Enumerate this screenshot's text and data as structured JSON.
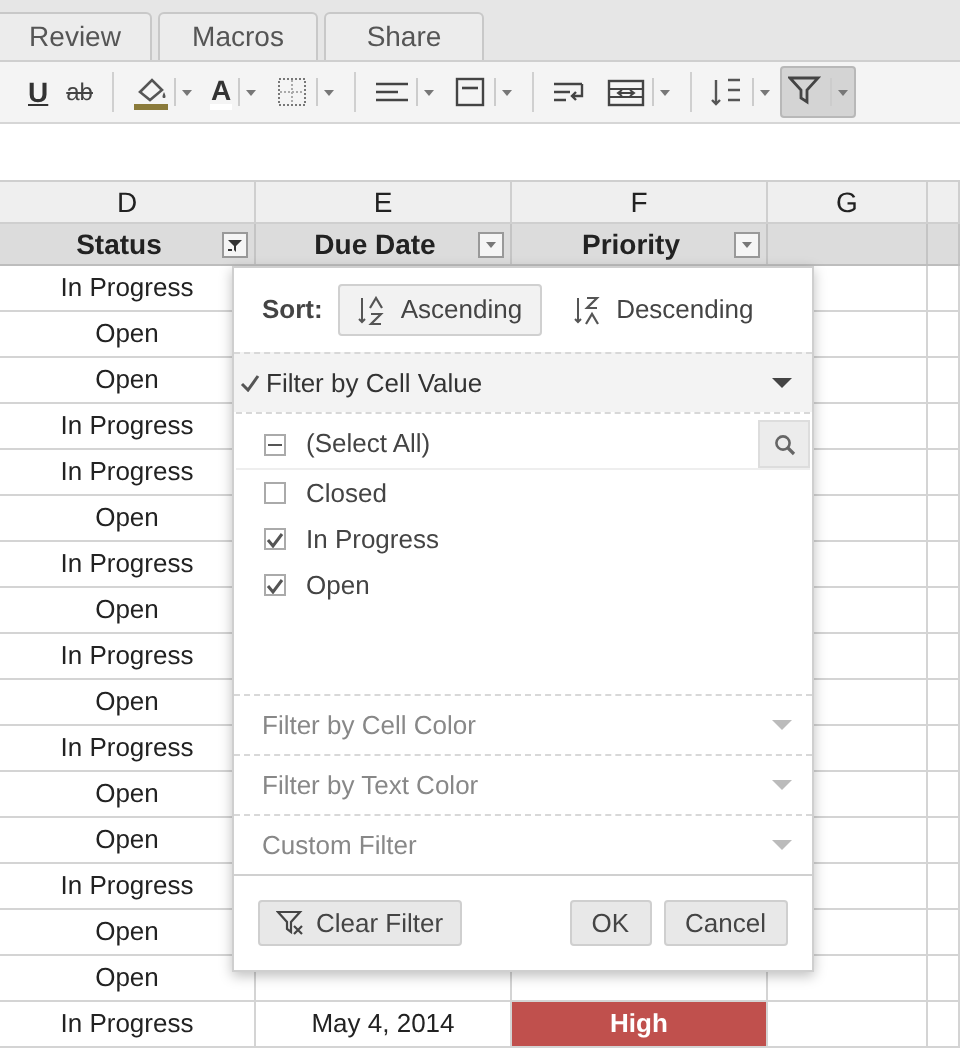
{
  "tabs": [
    {
      "label": "Review"
    },
    {
      "label": "Macros"
    },
    {
      "label": "Share"
    }
  ],
  "toolbar": [
    {
      "kind": "underline",
      "glyph": "U",
      "pressed": false
    },
    {
      "kind": "strike",
      "glyph": "ab",
      "pressed": false
    },
    {
      "kind": "separator"
    },
    {
      "kind": "fill",
      "menu": true,
      "pressed": false
    },
    {
      "kind": "font_color",
      "glyph": "A",
      "menu": true,
      "pressed": false
    },
    {
      "kind": "borders",
      "menu": true,
      "pressed": false
    },
    {
      "kind": "separator"
    },
    {
      "kind": "align",
      "menu": true,
      "pressed": false
    },
    {
      "kind": "valign",
      "menu": true,
      "pressed": false
    },
    {
      "kind": "separator"
    },
    {
      "kind": "wrap",
      "menu": false,
      "pressed": false
    },
    {
      "kind": "merge",
      "menu": true,
      "pressed": false
    },
    {
      "kind": "separator"
    },
    {
      "kind": "sort",
      "menu": true,
      "pressed": false
    },
    {
      "kind": "filter",
      "menu": true,
      "pressed": true
    }
  ],
  "columns": [
    "D",
    "E",
    "F",
    "G"
  ],
  "header_row": [
    {
      "label": "Status",
      "filtered": true
    },
    {
      "label": "Due Date",
      "filtered": false
    },
    {
      "label": "Priority",
      "filtered": false
    }
  ],
  "rows": [
    {
      "status": "In Progress"
    },
    {
      "status": "Open"
    },
    {
      "status": "Open"
    },
    {
      "status": "In Progress"
    },
    {
      "status": "In Progress"
    },
    {
      "status": "Open"
    },
    {
      "status": "In Progress"
    },
    {
      "status": "Open"
    },
    {
      "status": "In Progress"
    },
    {
      "status": "Open"
    },
    {
      "status": "In Progress"
    },
    {
      "status": "Open"
    },
    {
      "status": "Open"
    },
    {
      "status": "In Progress"
    },
    {
      "status": "Open"
    },
    {
      "status": "Open"
    },
    {
      "status": "In Progress",
      "due_date": "May 4, 2014",
      "priority": "High",
      "color": "#c0504d"
    }
  ],
  "filter_popup": {
    "sort": {
      "label": "Sort:",
      "options": [
        {
          "label": "Ascending",
          "kind": "ascending",
          "selected": true
        },
        {
          "label": "Descending",
          "kind": "descending",
          "selected": false
        }
      ]
    },
    "sections": [
      {
        "label": "Filter by Cell Value",
        "checked": true,
        "expanded": true
      },
      {
        "label": "Filter by Cell Color",
        "checked": false,
        "expanded": false
      },
      {
        "label": "Filter by Text Color",
        "checked": false,
        "expanded": false
      },
      {
        "label": "Custom Filter",
        "checked": false,
        "expanded": false
      }
    ],
    "select_all": {
      "label": "(Select All)",
      "indeterminate": true
    },
    "values": [
      {
        "label": "Closed",
        "checked": false
      },
      {
        "label": "In Progress",
        "checked": true
      },
      {
        "label": "Open",
        "checked": true
      }
    ],
    "clear_button": "Clear Filter",
    "ok_button": "OK",
    "cancel_button": "Cancel"
  }
}
